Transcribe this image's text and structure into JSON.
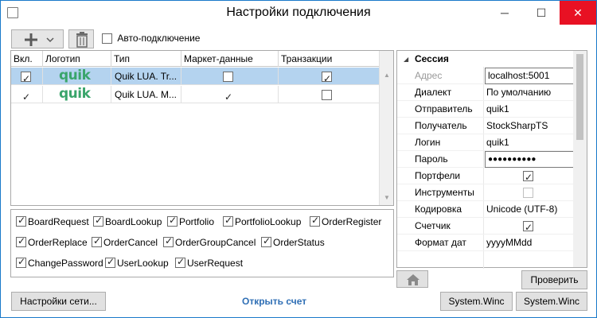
{
  "window": {
    "title": "Настройки подключения"
  },
  "toolbar": {
    "add_icon": "plus-icon",
    "auto_connect_label": "Авто-подключение",
    "auto_connect_checked": false
  },
  "grid": {
    "columns": [
      "Вкл.",
      "Логотип",
      "Тип",
      "Маркет-данные",
      "Транзакции"
    ],
    "rows": [
      {
        "enabled": true,
        "logo": "quik",
        "type": "Quik LUA. Tr...",
        "market_data": false,
        "transactions": true,
        "selected": true
      },
      {
        "enabled": true,
        "logo": "quik",
        "type": "Quik LUA. M...",
        "market_data": true,
        "transactions": false,
        "selected": false
      }
    ]
  },
  "messages": {
    "items": [
      {
        "label": "BoardRequest",
        "checked": true
      },
      {
        "label": "BoardLookup",
        "checked": true
      },
      {
        "label": "Portfolio",
        "checked": true
      },
      {
        "label": "PortfolioLookup",
        "checked": true
      },
      {
        "label": "OrderRegister",
        "checked": true
      },
      {
        "label": "OrderReplace",
        "checked": true
      },
      {
        "label": "OrderCancel",
        "checked": true
      },
      {
        "label": "OrderGroupCancel",
        "checked": true
      },
      {
        "label": "OrderStatus",
        "checked": true
      },
      {
        "label": "ChangePassword",
        "checked": true
      },
      {
        "label": "UserLookup",
        "checked": true
      },
      {
        "label": "UserRequest",
        "checked": true
      }
    ]
  },
  "props": {
    "section": "Сессия",
    "rows": [
      {
        "label": "Адрес",
        "value": "localhost:5001",
        "kind": "boxed",
        "disabled": true
      },
      {
        "label": "Диалект",
        "value": "По умолчанию",
        "kind": "text"
      },
      {
        "label": "Отправитель",
        "value": "quik1",
        "kind": "text"
      },
      {
        "label": "Получатель",
        "value": "StockSharpTS",
        "kind": "text"
      },
      {
        "label": "Логин",
        "value": "quik1",
        "kind": "text"
      },
      {
        "label": "Пароль",
        "value": "●●●●●●●●●●",
        "kind": "boxed"
      },
      {
        "label": "Портфели",
        "value": "",
        "kind": "check",
        "checked": true
      },
      {
        "label": "Инструменты",
        "value": "",
        "kind": "check",
        "checked": false
      },
      {
        "label": "Кодировка",
        "value": "Unicode (UTF-8)",
        "kind": "text"
      },
      {
        "label": "Счетчик",
        "value": "",
        "kind": "check",
        "checked": true
      },
      {
        "label": "Формат дат",
        "value": "yyyyMMdd",
        "kind": "text"
      }
    ]
  },
  "buttons": {
    "check": "Проверить",
    "network_settings": "Настройки сети...",
    "open_account": "Открыть счет",
    "system1": "System.Winc",
    "system2": "System.Winc"
  }
}
